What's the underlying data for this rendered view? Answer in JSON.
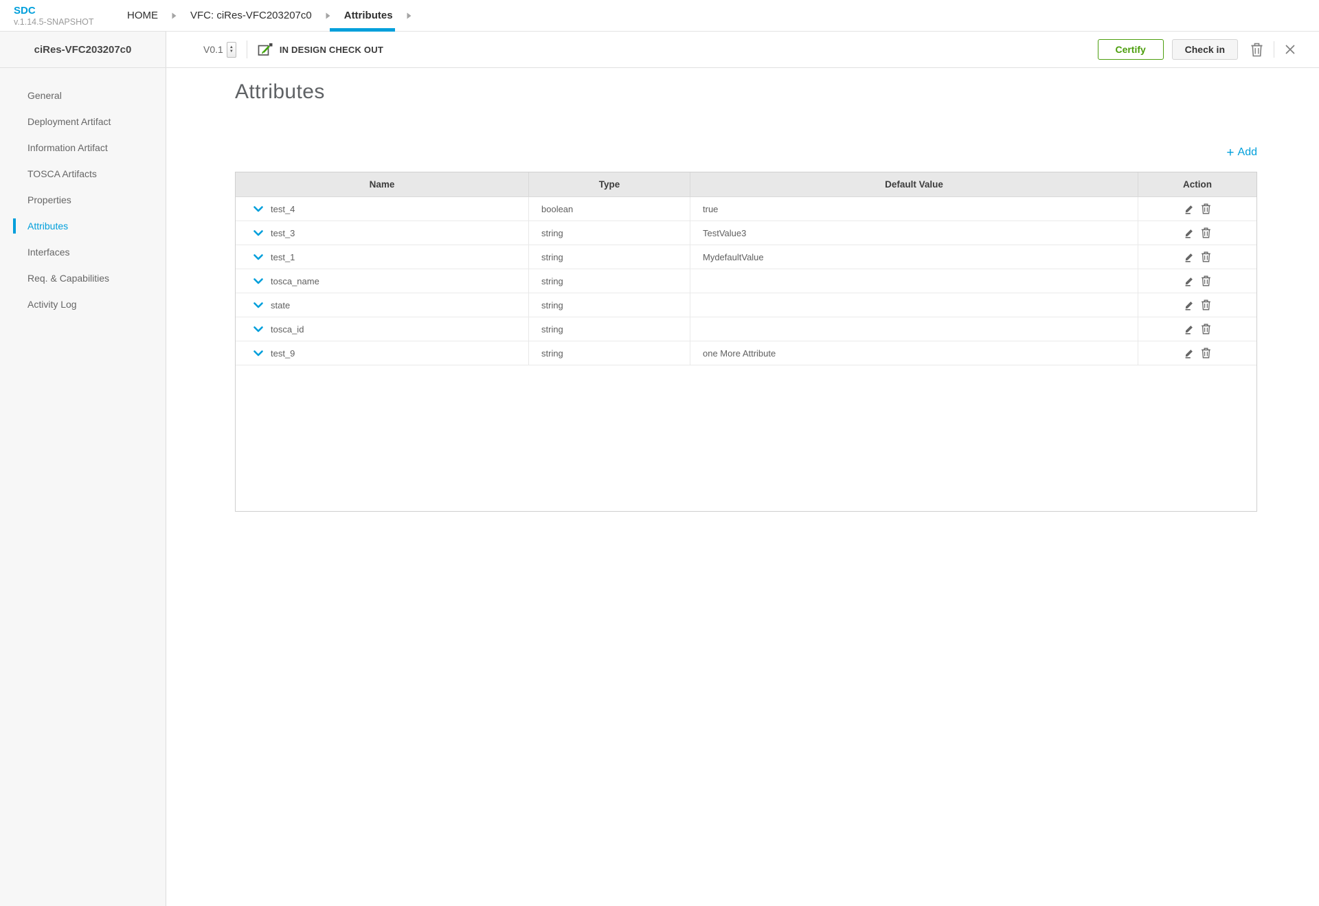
{
  "colors": {
    "accent": "#009fdb",
    "green": "#4c9e0d"
  },
  "app": {
    "logo": "SDC",
    "version": "v.1.14.5-SNAPSHOT"
  },
  "breadcrumb": {
    "items": [
      {
        "label": "HOME",
        "active": false
      },
      {
        "label": "VFC: ciRes-VFC203207c0",
        "active": false
      },
      {
        "label": "Attributes",
        "active": true
      }
    ]
  },
  "toolbar": {
    "version_label": "V0.1",
    "status_label": "IN DESIGN CHECK OUT",
    "certify_label": "Certify",
    "checkin_label": "Check in"
  },
  "sidebar": {
    "title": "ciRes-VFC203207c0",
    "items": [
      {
        "label": "General",
        "active": false
      },
      {
        "label": "Deployment Artifact",
        "active": false
      },
      {
        "label": "Information Artifact",
        "active": false
      },
      {
        "label": "TOSCA Artifacts",
        "active": false
      },
      {
        "label": "Properties",
        "active": false
      },
      {
        "label": "Attributes",
        "active": true
      },
      {
        "label": "Interfaces",
        "active": false
      },
      {
        "label": "Req. & Capabilities",
        "active": false
      },
      {
        "label": "Activity Log",
        "active": false
      }
    ]
  },
  "main": {
    "title": "Attributes",
    "add_plus": "+",
    "add_label": "Add",
    "table": {
      "columns": [
        "Name",
        "Type",
        "Default Value",
        "Action"
      ],
      "rows": [
        {
          "name": "test_4",
          "type": "boolean",
          "default_value": "true"
        },
        {
          "name": "test_3",
          "type": "string",
          "default_value": "TestValue3"
        },
        {
          "name": "test_1",
          "type": "string",
          "default_value": "MydefaultValue"
        },
        {
          "name": "tosca_name",
          "type": "string",
          "default_value": ""
        },
        {
          "name": "state",
          "type": "string",
          "default_value": ""
        },
        {
          "name": "tosca_id",
          "type": "string",
          "default_value": ""
        },
        {
          "name": "test_9",
          "type": "string",
          "default_value": "one More Attribute"
        }
      ]
    }
  }
}
